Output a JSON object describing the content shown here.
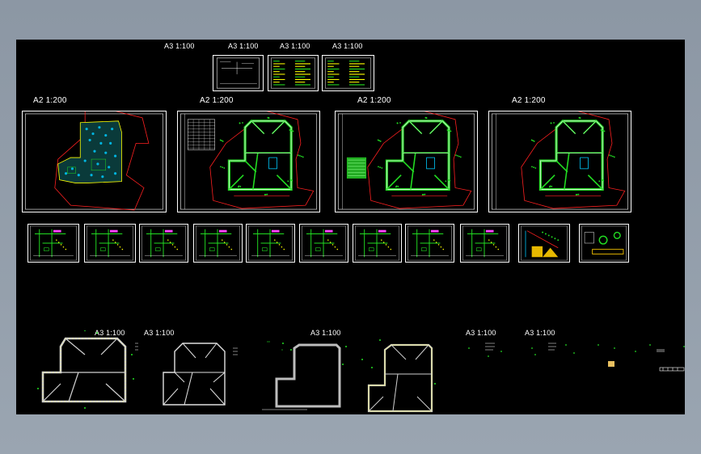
{
  "drawing": {
    "scale_labels": {
      "a3_top_1": "A3 1:100",
      "a3_top_2": "A3 1:100",
      "a3_top_3": "A3 1:100",
      "a3_top_4": "A3 1:100",
      "a2_1": "A2  1:200",
      "a2_2": "A2  1:200",
      "a2_3": "A2  1:200",
      "a2_4": "A2  1:200",
      "a3_bot_1": "A3  1:100",
      "a3_bot_2": "A3  1:100",
      "a3_bot_3": "A3 1:100",
      "a3_bot_4": "A3  1:100",
      "a3_bot_5": "A3  1:100"
    }
  },
  "colors": {
    "background": "#000000",
    "frame": "#ffffff",
    "boundary": "#ff2020",
    "structure": "#22dd22",
    "annotation": "#ffff00",
    "accent": "#00ccff",
    "wall_gray": "#c8c8c8"
  }
}
